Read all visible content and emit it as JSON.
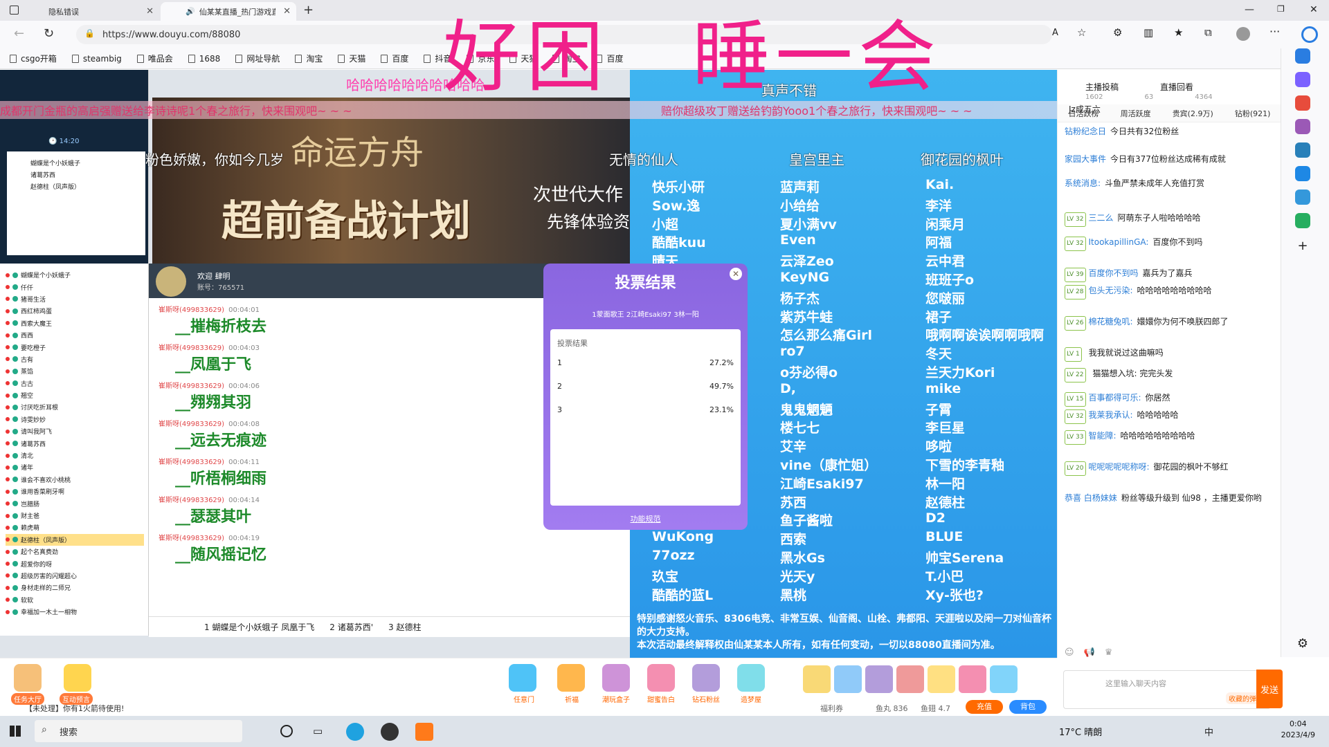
{
  "browser": {
    "tabs": [
      {
        "title": "隐私错误",
        "active": false
      },
      {
        "title": "仙某某直播_热门游戏直播_斗",
        "active": true
      }
    ],
    "url": "https://www.douyu.com/88080",
    "bookmarks": [
      "csgo开箱",
      "steambig",
      "唯品会",
      "1688",
      "网址导航",
      "淘宝",
      "天猫",
      "百度",
      "抖音",
      "京东",
      "天猫",
      "淘宝",
      "百度"
    ]
  },
  "overlay_title": "好困　睡一会",
  "danmu": [
    {
      "text": "成都开门金瓶的高启强赠送给李诗诗呢1个春之旅行，快来围观吧~ ~ ~",
      "color": "#e0356b"
    },
    {
      "text": "哈哈哈哈哈哈哈哈哈哈",
      "color": "#ff3fae"
    },
    {
      "text": "赔你超级攻丁赠送给钓韵Yooo1个春之旅行，快来围观吧~ ~ ~",
      "color": "#e0356b"
    },
    {
      "text": "粉色娇嫩，你如今几岁",
      "color": "#ffffff"
    },
    {
      "text": "无情的仙人",
      "color": "#ffffff"
    },
    {
      "text": "御花园的枫叶",
      "color": "#ffffff"
    },
    {
      "text": "皇宫里主",
      "color": "#ffffff"
    },
    {
      "text": "真声不错",
      "color": "#ffffff"
    }
  ],
  "game_banner": {
    "title": "超前备战计划",
    "subtitle": "命运方舟",
    "tag1": "次世代大作",
    "tag2": "先锋体验资"
  },
  "obs_left": {
    "time": "14:20",
    "list": [
      "蝴蝶是个小妖蛾子",
      "诸葛苏西",
      "赵德柱（凤声版）",
      "仟仟",
      "猪哥生活",
      "西红柿鸡蛋",
      "西索大魔王",
      "西西",
      "要吃橙子",
      "古有",
      "蒸馅",
      "古古",
      "翘空",
      "讨厌吃折耳根",
      "诗雯妙妙",
      "请叫我阿飞",
      "诸葛苏西",
      "清北",
      "诸年",
      "谁会不喜欢小桃桃",
      "谁用香菜刷牙啊",
      "岂腊肠",
      "财主爸",
      "赖虎萌",
      "赵德柱（凤声版）",
      "起个名真费劲",
      "超爱你的呀",
      "超级厉害的闪耀超心",
      "身材走样的二师兄",
      "软软",
      "幸福加一木土一相物"
    ]
  },
  "chat": {
    "welcome": "欢迎 肆明",
    "room": "账号：765571",
    "messages": [
      {
        "user": "崔斯呀(499833629)",
        "time": "00:04:01",
        "text": "__摧梅折枝去"
      },
      {
        "user": "崔斯呀(499833629)",
        "time": "00:04:03",
        "text": "__凤凰于飞"
      },
      {
        "user": "崔斯呀(499833629)",
        "time": "00:04:06",
        "text": "__翙翙其羽"
      },
      {
        "user": "崔斯呀(499833629)",
        "time": "00:04:08",
        "text": "__远去无痕迹"
      },
      {
        "user": "崔斯呀(499833629)",
        "time": "00:04:11",
        "text": "__听梧桐细雨"
      },
      {
        "user": "崔斯呀(499833629)",
        "time": "00:04:14",
        "text": "__瑟瑟其叶"
      },
      {
        "user": "崔斯呀(499833629)",
        "time": "00:04:19",
        "text": "__随风摇记忆"
      }
    ],
    "vote_items": [
      "1 蝴蝶是个小妖蛾子 凤凰于飞",
      "2 诸葛苏西'",
      "3 赵德柱"
    ]
  },
  "vote_modal": {
    "title": "投票结果",
    "options": "1蒙面歌王 2江崎Esaki97 3林一阳",
    "header": "投票结果",
    "rows": [
      {
        "label": "1",
        "pct": "27.2%"
      },
      {
        "label": "2",
        "pct": "49.7%"
      },
      {
        "label": "3",
        "pct": "23.1%"
      }
    ],
    "rule": "功能规范"
  },
  "credits": {
    "names": [
      "快乐小研",
      "蓝声莉",
      "Kai.",
      "Sow.逸",
      "小给给",
      "李洋",
      "小超",
      "夏小满vv",
      "闲乘月",
      "酷酷kuu",
      "Even",
      "阿福",
      "晴天",
      "云泽Zeo",
      "云中君",
      "",
      "KeyNG",
      "班班子o",
      "",
      "杨子杰",
      "您啵丽",
      "",
      "紫苏牛蛙",
      "裙子",
      "",
      "怎么那么痛Girl",
      "哦啊啊诶诶啊啊哦啊",
      "",
      "ro7",
      "冬天",
      "",
      "o芬必得o",
      "兰天力Kori",
      "",
      "D,",
      "mike",
      "",
      "鬼鬼魍魉",
      "子霄",
      "",
      "楼七七",
      "李巨星",
      "",
      "艾辛",
      "哆啦",
      "",
      "vine（康忙姐）",
      "下雪的李青釉",
      "",
      "江崎Esaki97",
      "林一阳",
      "",
      "苏西",
      "赵德柱",
      "",
      "鱼子酱啦",
      "D2",
      "WuKong",
      "西索",
      "BLUE",
      "77ozz",
      "黑水Gs",
      "帅宝Serena",
      "玖宝",
      "光天y",
      "T.小巴",
      "酷酷的蓝L",
      "黑桃",
      "Xy-张也?"
    ],
    "thanks": "特别感谢怒火音乐、8306电竞、非常互娱、仙音阁、山栓、弗都阳、天涯啦以及闲一刀对仙音杯的大力支持。\n本次活动最终解释权由仙某某本人所有，如有任何变动，一切以88080直播间为准。"
  },
  "right_panel": {
    "top_btn1": "主播投稿",
    "top_btn2": "直播回看",
    "count1": "1602",
    "count2": "63",
    "count3": "4364",
    "tabs": [
      "日活跃榜",
      "周活跃度",
      "贵宾(2.9万)",
      "钻粉(921)"
    ],
    "messages": [
      {
        "lv": "",
        "user": "",
        "text": "Jz成五六"
      },
      {
        "lv": "",
        "user": "钻粉纪念日",
        "text": "今日共有32位粉丝"
      },
      {
        "lv": "",
        "user": "家园大事件",
        "text": "今日有377位粉丝达成稀有成就"
      },
      {
        "lv": "",
        "user": "系统消息:",
        "text": "斗鱼严禁未成年人充值打赏"
      },
      {
        "lv": "LV 32",
        "user": "三二么",
        "text": "阿萌东子人啦哈哈哈哈"
      },
      {
        "lv": "LV 32",
        "user": "ItookapillinGA:",
        "text": "百度你不到吗"
      },
      {
        "lv": "LV 39",
        "user": "百度你不到吗",
        "text": "嘉兵为了嘉兵"
      },
      {
        "lv": "LV 28",
        "user": "包头无污染:",
        "text": "哈哈哈哈哈哈哈哈哈"
      },
      {
        "lv": "LV 26",
        "user": "棉花糖兔叽:",
        "text": "嬛嬛你为何不唤朕四郎了"
      },
      {
        "lv": "LV 1",
        "user": "",
        "text": "我我就说过这曲嘛吗"
      },
      {
        "lv": "LV 22",
        "user": "",
        "text": "猫猫想入坑:    完完头发"
      },
      {
        "lv": "LV 15",
        "user": "百事都得可乐:",
        "text": "你居然"
      },
      {
        "lv": "LV 32",
        "user": "我莱我承认:",
        "text": "哈哈哈哈哈"
      },
      {
        "lv": "LV 33",
        "user": "智能障:",
        "text": "哈哈哈哈哈哈哈哈哈"
      },
      {
        "lv": "LV 20",
        "user": "呢呢呢呢呢称呀:",
        "text": "御花园的枫叶不够红"
      },
      {
        "lv": "",
        "user": "恭喜 白杨妹妹",
        "text": "粉丝等级升级到 仙98 ，主播更爱你哟"
      }
    ],
    "input_placeholder": "这里输入聊天内容",
    "send": "发送",
    "danmu_label": "收藏的弹幕"
  },
  "bottom": {
    "gifts_left": [
      "任务大厅",
      "互动预言"
    ],
    "gifts_mid": [
      "任意门",
      "祈福",
      "潮玩盒子",
      "甜蜜告白",
      "钻石粉丝",
      "造梦屋"
    ],
    "fish_ball": "鱼丸 836",
    "fish_fin": "鱼翅 4.7",
    "recharge": "充值",
    "bag": "背包",
    "welfare": "福利券",
    "notice": "【未处理】你有1火箭待使用!"
  },
  "taskbar": {
    "search": "搜索",
    "weather": "17°C 晴朗",
    "time": "0:04",
    "date": "2023/4/9",
    "ime": "中"
  },
  "colors": {
    "accent": "#ff6a00",
    "title_pink": "#f0208a",
    "credits_bg": "#3fb4f0",
    "vote_purple": "#8a66e0"
  }
}
